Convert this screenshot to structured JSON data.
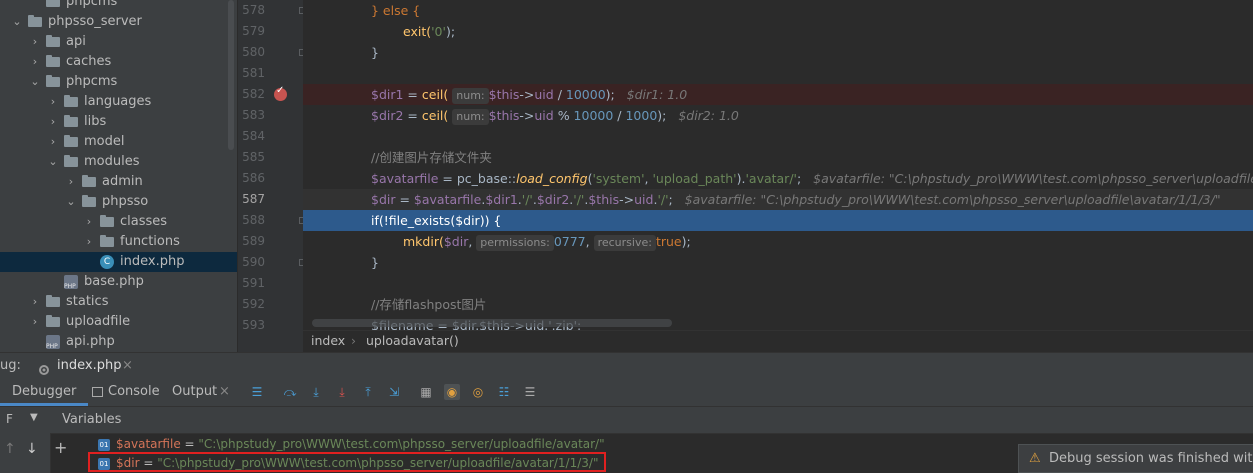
{
  "tree": {
    "items": [
      {
        "label": "phpcms",
        "icon": "folder-icon",
        "chev": ""
      },
      {
        "label": "phpsso_server",
        "icon": "folder-icon",
        "chev": "▼"
      },
      {
        "label": "api",
        "icon": "folder-icon",
        "chev": "›"
      },
      {
        "label": "caches",
        "icon": "folder-icon",
        "chev": "›"
      },
      {
        "label": "phpcms",
        "icon": "folder-icon",
        "chev": "▼"
      },
      {
        "label": "languages",
        "icon": "folder-icon",
        "chev": "›"
      },
      {
        "label": "libs",
        "icon": "folder-icon",
        "chev": "›"
      },
      {
        "label": "model",
        "icon": "folder-icon",
        "chev": "›"
      },
      {
        "label": "modules",
        "icon": "folder-icon",
        "chev": "▼"
      },
      {
        "label": "admin",
        "icon": "folder-icon",
        "chev": "›"
      },
      {
        "label": "phpsso",
        "icon": "folder-icon",
        "chev": "▼"
      },
      {
        "label": "classes",
        "icon": "folder-icon",
        "chev": "›"
      },
      {
        "label": "functions",
        "icon": "folder-icon",
        "chev": "›"
      },
      {
        "label": "index.php",
        "icon": "class-file-icon",
        "chev": ""
      },
      {
        "label": "base.php",
        "icon": "php-file-icon",
        "chev": ""
      },
      {
        "label": "statics",
        "icon": "folder-icon",
        "chev": "›"
      },
      {
        "label": "uploadfile",
        "icon": "folder-icon",
        "chev": "›"
      },
      {
        "label": "api.php",
        "icon": "php-file-icon",
        "chev": ""
      }
    ]
  },
  "gutter": {
    "lines": [
      "578",
      "579",
      "580",
      "581",
      "582",
      "583",
      "584",
      "585",
      "586",
      "587",
      "588",
      "589",
      "590",
      "591",
      "592",
      "593"
    ],
    "current_line": "587",
    "breakpoint_line": "582"
  },
  "code": {
    "l578": {
      "kw": "} else {"
    },
    "l579": {
      "fn": "exit(",
      "str": "'0'",
      "end": ");"
    },
    "l580": {
      "text": "}"
    },
    "l582": {
      "var": "$dir1",
      "eq": " = ",
      "fn": "ceil(",
      "hint": "num:",
      "var2": "$this",
      "arrow": "->",
      "prop": "uid",
      "op": " / ",
      "num": "10000",
      "end": ");",
      "inline": "$dir1: 1.0"
    },
    "l583": {
      "var": "$dir2",
      "eq": " = ",
      "fn": "ceil(",
      "hint": "num:",
      "var2": "$this",
      "arrow": "->",
      "prop": "uid",
      "op": " % ",
      "num": "10000",
      "op2": " / ",
      "num2": "1000",
      "end": ");",
      "inline": "$dir2: 1.0"
    },
    "l585": {
      "comment": "//创建图片存储文件夹"
    },
    "l586": {
      "var": "$avatarfile",
      "eq": " = ",
      "cls": "pc_base",
      "sep": "::",
      "stat": "load_config",
      "open": "(",
      "s1": "'system'",
      "comma": ", ",
      "s2": "'upload_path'",
      "close": ").",
      "s3": "'avatar/'",
      "end": ";",
      "inline": "$avatarfile: \"C:\\phpstudy_pro\\WWW\\test.com\\phpsso_server\\uploadfile\\avatar/\""
    },
    "l587": {
      "var": "$dir",
      "eq": " = ",
      "var2": "$avatarfile",
      "dot": ".",
      "var3": "$dir1",
      "dot2": ".",
      "s1": "'/'",
      "dot3": ".",
      "var4": "$dir2",
      "dot4": ".",
      "s2": "'/'",
      "dot5": ".",
      "var5": "$this",
      "arrow": "->",
      "prop": "uid",
      "dot6": ".",
      "s3": "'/'",
      "end": ";",
      "inline": "$avatarfile: \"C:\\phpstudy_pro\\WWW\\test.com\\phpsso_server\\uploadfile\\avatar/1/1/3/\""
    },
    "l588": {
      "text": "if(!file_exists($dir)) {"
    },
    "l589": {
      "fn": "mkdir(",
      "var": "$dir",
      "comma": ", ",
      "hint1": "permissions:",
      "num": "0777",
      "comma2": ", ",
      "hint2": "recursive:",
      "kw": "true",
      "end": ");"
    },
    "l590": {
      "text": "}"
    },
    "l592": {
      "comment": "//存储flashpost图片"
    },
    "l593": {
      "text": "$filename = $dir.$this->uid.'.zip';"
    }
  },
  "breadcrumb": {
    "a": "index",
    "sep": "›",
    "b": "uploadavatar()"
  },
  "debug": {
    "title_prefix": "ug:",
    "file_tab": "index.php",
    "close": "×",
    "tabs": {
      "debugger": "Debugger",
      "console": "Console",
      "output": "Output"
    },
    "variables_label": "Variables",
    "vars": [
      {
        "name": "$avatarfile",
        "eq": " = ",
        "value": "\"C:\\phpstudy_pro\\WWW\\test.com\\phpsso_server/uploadfile/avatar/\""
      },
      {
        "name": "$dir",
        "eq": " = ",
        "value": "\"C:\\phpstudy_pro\\WWW\\test.com\\phpsso_server/uploadfile/avatar/1/1/3/\""
      }
    ],
    "toast": "Debug session was finished with"
  },
  "colors": {
    "accent": "#4a88c7",
    "exec_line": "#2d5a8c",
    "highlight_box": "#e02020"
  }
}
